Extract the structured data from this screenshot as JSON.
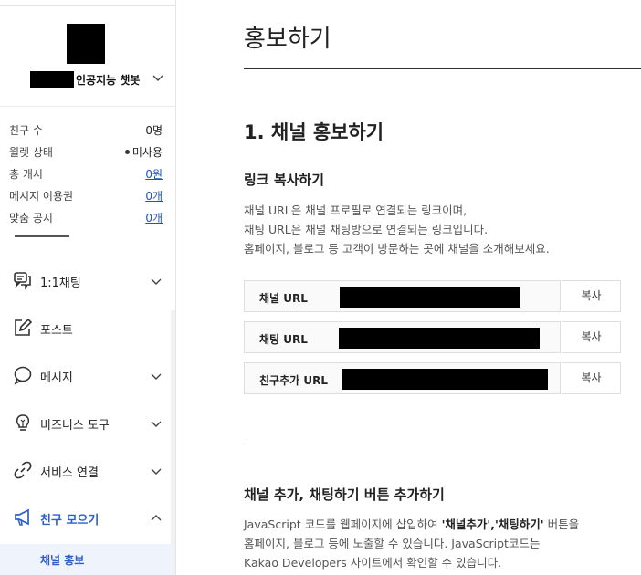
{
  "sidebar": {
    "channel_name_suffix": "인공지능 챗봇",
    "stats": [
      {
        "label": "친구 수",
        "value": "0명",
        "link": false
      },
      {
        "label": "월렛 상태",
        "value": "미사용",
        "link": false,
        "dot": true
      },
      {
        "label": "총 캐시",
        "value": "0원",
        "link": true
      },
      {
        "label": "메시지 이용권",
        "value": "0개",
        "link": true
      },
      {
        "label": "맞춤 공지",
        "value": "0개",
        "link": true
      }
    ],
    "menu": [
      {
        "label": "1:1채팅",
        "icon": "chat-bubbles-icon",
        "expandable": true
      },
      {
        "label": "포스트",
        "icon": "edit-post-icon",
        "expandable": false
      },
      {
        "label": "메시지",
        "icon": "message-bubble-icon",
        "expandable": true
      },
      {
        "label": "비즈니스 도구",
        "icon": "bulb-icon",
        "expandable": true
      },
      {
        "label": "서비스 연결",
        "icon": "link-icon",
        "expandable": true
      },
      {
        "label": "친구 모으기",
        "icon": "megaphone-icon",
        "expandable": true,
        "active": true
      }
    ],
    "submenu_active": "채널 홍보"
  },
  "main": {
    "page_title": "홍보하기",
    "section_title": "1. 채널 홍보하기",
    "link_copy": {
      "title": "링크 복사하기",
      "desc_lines": [
        "채널 URL은 채널 프로필로 연결되는 링크이며,",
        "채팅 URL은 채널 채팅방으로 연결되는 링크입니다.",
        "홈페이지, 블로그 등 고객이 방문하는 곳에 채널을 소개해보세요."
      ],
      "rows": [
        {
          "label": "채널 URL",
          "button": "복사"
        },
        {
          "label": "채팅 URL",
          "button": "복사"
        },
        {
          "label": "친구추가 URL",
          "button": "복사"
        }
      ]
    },
    "button_add": {
      "title": "채널 추가, 채팅하기 버튼 추가하기",
      "line1_a": "JavaScript 코드를 웹페이지에 삽입하여 ",
      "line1_b": "'채널추가','채팅하기'",
      "line1_c": " 버튼을",
      "line2": "홈페이지, 블로그 등에 노출할 수 있습니다. JavaScript코드는",
      "line3": "Kakao Developers 사이트에서 확인할 수 있습니다."
    }
  },
  "colors": {
    "accent": "#2b5fc7",
    "link": "#1a56b8",
    "submenu_bg": "#eef3fc"
  }
}
